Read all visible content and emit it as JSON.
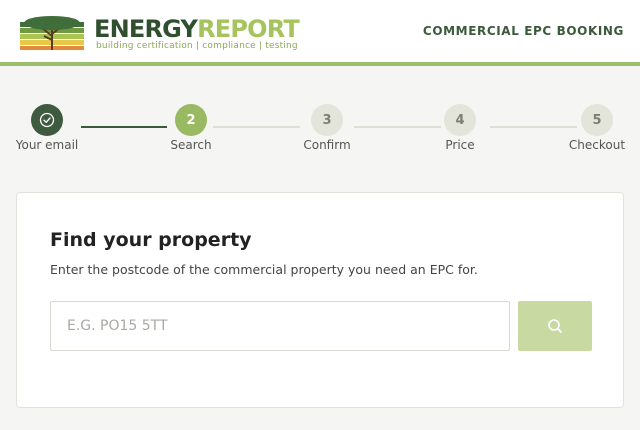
{
  "logo": {
    "word_energy": "ENERGY",
    "word_report": "REPORT",
    "tagline": "building certification | compliance | testing"
  },
  "header": {
    "title": "COMMERCIAL EPC BOOKING"
  },
  "steps": [
    {
      "label": "Your email",
      "number": "",
      "state": "done"
    },
    {
      "label": "Search",
      "number": "2",
      "state": "active"
    },
    {
      "label": "Confirm",
      "number": "3",
      "state": "todo"
    },
    {
      "label": "Price",
      "number": "4",
      "state": "todo"
    },
    {
      "label": "Checkout",
      "number": "5",
      "state": "todo"
    }
  ],
  "card": {
    "title": "Find your property",
    "subtitle": "Enter the postcode of the commercial property you need an EPC for.",
    "input": {
      "value": "",
      "placeholder": "E.G. PO15 5TT"
    }
  },
  "colors": {
    "brand_dark": "#3f5b3f",
    "brand_light": "#9ab963",
    "search_button": "#c8d9a1"
  },
  "icons": {
    "completed_step": "check-icon",
    "search": "search-icon",
    "logo": "tree-logo-icon"
  }
}
